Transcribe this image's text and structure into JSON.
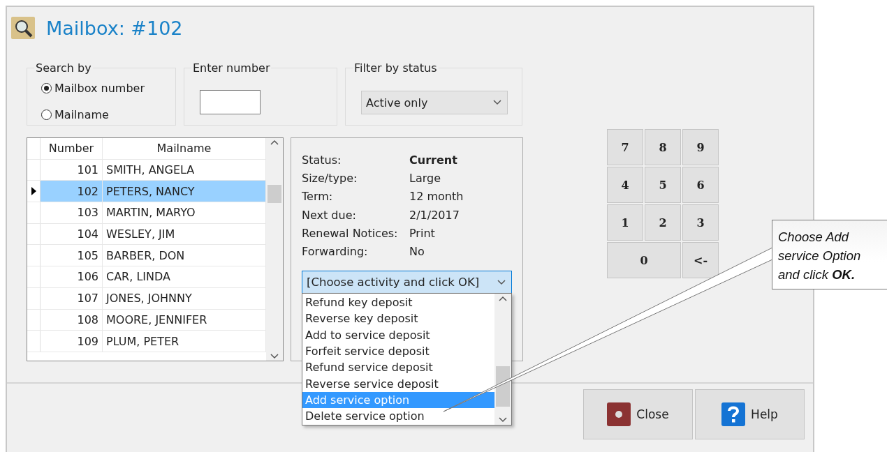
{
  "window": {
    "title": "Mailbox: #102"
  },
  "search_by": {
    "label": "Search by",
    "options": [
      {
        "label": "Mailbox number",
        "selected": true
      },
      {
        "label": "Mailname",
        "selected": false
      }
    ]
  },
  "enter_number": {
    "label": "Enter number"
  },
  "filter_by_status": {
    "label": "Filter by status",
    "value": "Active only"
  },
  "table": {
    "columns": [
      "Number",
      "Mailname"
    ],
    "rows": [
      {
        "number": "101",
        "mailname": "SMITH, ANGELA",
        "selected": false
      },
      {
        "number": "102",
        "mailname": "PETERS, NANCY",
        "selected": true
      },
      {
        "number": "103",
        "mailname": "MARTIN, MARYO",
        "selected": false
      },
      {
        "number": "104",
        "mailname": "WESLEY, JIM",
        "selected": false
      },
      {
        "number": "105",
        "mailname": "BARBER, DON",
        "selected": false
      },
      {
        "number": "106",
        "mailname": "CAR, LINDA",
        "selected": false
      },
      {
        "number": "107",
        "mailname": "JONES, JOHNNY",
        "selected": false
      },
      {
        "number": "108",
        "mailname": "MOORE, JENNIFER",
        "selected": false
      },
      {
        "number": "109",
        "mailname": "PLUM, PETER",
        "selected": false
      }
    ]
  },
  "details": [
    {
      "label": "Status:",
      "value": "Current",
      "bold": true
    },
    {
      "label": "Size/type:",
      "value": "Large",
      "bold": false
    },
    {
      "label": "Term:",
      "value": "12 month",
      "bold": false
    },
    {
      "label": "Next due:",
      "value": "2/1/2017",
      "bold": false
    },
    {
      "label": "Renewal Notices:",
      "value": "Print",
      "bold": false
    },
    {
      "label": "Forwarding:",
      "value": "No",
      "bold": false
    }
  ],
  "activity": {
    "value": "[Choose activity and click OK]",
    "expanded": true,
    "options": [
      {
        "label": "Refund key deposit",
        "selected": false
      },
      {
        "label": "Reverse key deposit",
        "selected": false
      },
      {
        "label": "Add to service deposit",
        "selected": false
      },
      {
        "label": "Forfeit service deposit",
        "selected": false
      },
      {
        "label": "Refund service deposit",
        "selected": false
      },
      {
        "label": "Reverse service deposit",
        "selected": false
      },
      {
        "label": "Add service option",
        "selected": true
      },
      {
        "label": "Delete service option",
        "selected": false
      }
    ]
  },
  "keypad": [
    {
      "label": "7",
      "wide": false
    },
    {
      "label": "8",
      "wide": false
    },
    {
      "label": "9",
      "wide": false
    },
    {
      "label": "4",
      "wide": false
    },
    {
      "label": "5",
      "wide": false
    },
    {
      "label": "6",
      "wide": false
    },
    {
      "label": "1",
      "wide": false
    },
    {
      "label": "2",
      "wide": false
    },
    {
      "label": "3",
      "wide": false
    },
    {
      "label": "0",
      "wide": true
    },
    {
      "label": "<-",
      "wide": false
    }
  ],
  "buttons": [
    {
      "label": "Close",
      "kind": "close"
    },
    {
      "label": "Help",
      "kind": "help"
    }
  ],
  "callout": {
    "text": "Choose Add service Option and click **OK.**"
  }
}
